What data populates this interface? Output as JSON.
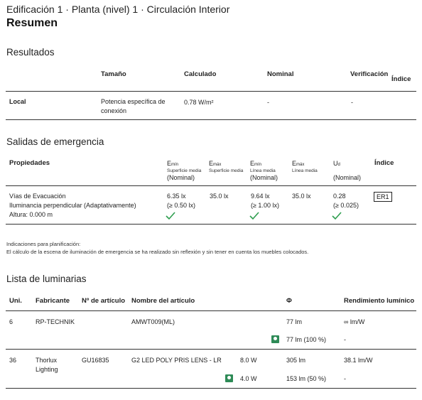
{
  "breadcrumb": "Edificación 1 · Planta (nivel) 1 · Circulación Interior",
  "title": "Resumen",
  "resultados": {
    "heading": "Resultados",
    "cols": [
      "Tamaño",
      "Calculado",
      "Nominal",
      "Verificación",
      "Índice"
    ],
    "row": {
      "label": "Local",
      "size": "Potencia específica de conexión",
      "size_l1": "Potencia específica de",
      "size_l2": "conexión",
      "calc": "0.78 W/m²",
      "nominal": "-",
      "verif": "-"
    }
  },
  "salidas": {
    "heading": "Salidas de emergencia",
    "props_label": "Propiedades",
    "cols": [
      {
        "main": "E",
        "sub": "mín",
        "desc": "Superficie media",
        "nominal": "(Nominal)"
      },
      {
        "main": "E",
        "sub": "máx",
        "desc": "Superficie media"
      },
      {
        "main": "E",
        "sub": "mín",
        "desc": "Línea media",
        "nominal": "(Nominal)"
      },
      {
        "main": "E",
        "sub": "máx",
        "desc": "Línea media"
      },
      {
        "main": "U",
        "sub": "d",
        "nominal": "(Nominal)"
      }
    ],
    "index_label": "Índice",
    "row": {
      "l1": "Vías de Evacuación",
      "l2": "Iluminancia perpendicular (Adaptativamente)",
      "l3": "Altura: 0.000 m",
      "emin_s": "6.35 lx",
      "emin_s_nom": "(≥ 0.50 lx)",
      "emax_s": "35.0 lx",
      "emin_l": "9.64 lx",
      "emin_l_nom": "(≥ 1.00 lx)",
      "emax_l": "35.0 lx",
      "ud": "0.28",
      "ud_nom": "(≥ 0.025)",
      "index": "ER1"
    },
    "check_color": "#2e9e4f"
  },
  "notes": {
    "l1": "Indicaciones para planificación:",
    "l2": "El cálculo de la escena de iluminación de emergencia se ha realizado sin reflexión y sin tener en cuenta los muebles colocados."
  },
  "luminarias": {
    "heading": "Lista de luminarias",
    "cols": [
      "Uni.",
      "Fabricante",
      "Nº de artículo",
      "Nombre del artículo",
      "Φ",
      "Rendimiento lumínico"
    ],
    "rows": [
      {
        "uni": "6",
        "fab": "RP-TECHNIK",
        "art": "",
        "name": "AMWT009(ML)",
        "power": "",
        "phi": "77 lm",
        "rend": "∞ lm/W",
        "em_power": "",
        "em_phi": "77 lm (100 %)",
        "em_rend": "-"
      },
      {
        "uni": "36",
        "fab": "Thorlux Lighting",
        "fab_l1": "Thorlux",
        "fab_l2": "Lighting",
        "art": "GU16835",
        "name": "G2 LED POLY PRIS LENS - LR",
        "power": "8.0 W",
        "phi": "305 lm",
        "rend": "38.1 lm/W",
        "em_power": "4.0 W",
        "em_phi": "153 lm (50 %)",
        "em_rend": "-"
      }
    ],
    "emergency_icon_color": "#2e8b57"
  }
}
